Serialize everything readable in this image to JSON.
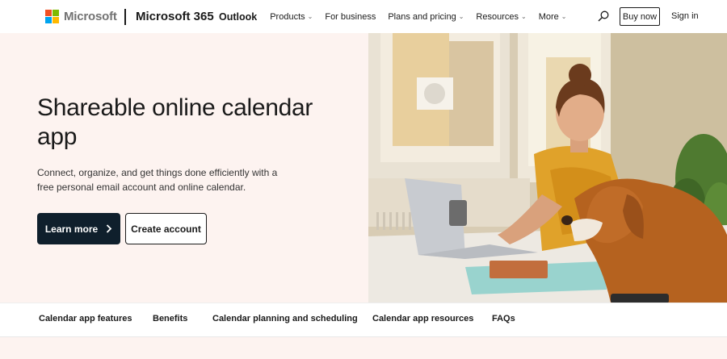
{
  "header": {
    "brand": "Microsoft",
    "product": "Microsoft 365",
    "nav": [
      {
        "label": "Outlook",
        "dropdown": false
      },
      {
        "label": "Products",
        "dropdown": true
      },
      {
        "label": "For business",
        "dropdown": false
      },
      {
        "label": "Plans and pricing",
        "dropdown": true
      },
      {
        "label": "Resources",
        "dropdown": true
      },
      {
        "label": "More",
        "dropdown": true
      }
    ],
    "buy_now": "Buy now",
    "sign_in": "Sign in"
  },
  "hero": {
    "title": "Shareable online calendar app",
    "subtitle": "Connect, organize, and get things done efficiently with a free personal email account and online calendar.",
    "primary_button": "Learn more",
    "secondary_button": "Create account"
  },
  "tabs": [
    "Calendar app features",
    "Benefits",
    "Calendar planning and scheduling",
    "Calendar app resources",
    "FAQs"
  ],
  "colors": {
    "hero_bg": "#fdf3f0",
    "primary_button": "#0f1f2c",
    "logo": [
      "#f25022",
      "#7fba00",
      "#00a4ef",
      "#ffb900"
    ]
  }
}
